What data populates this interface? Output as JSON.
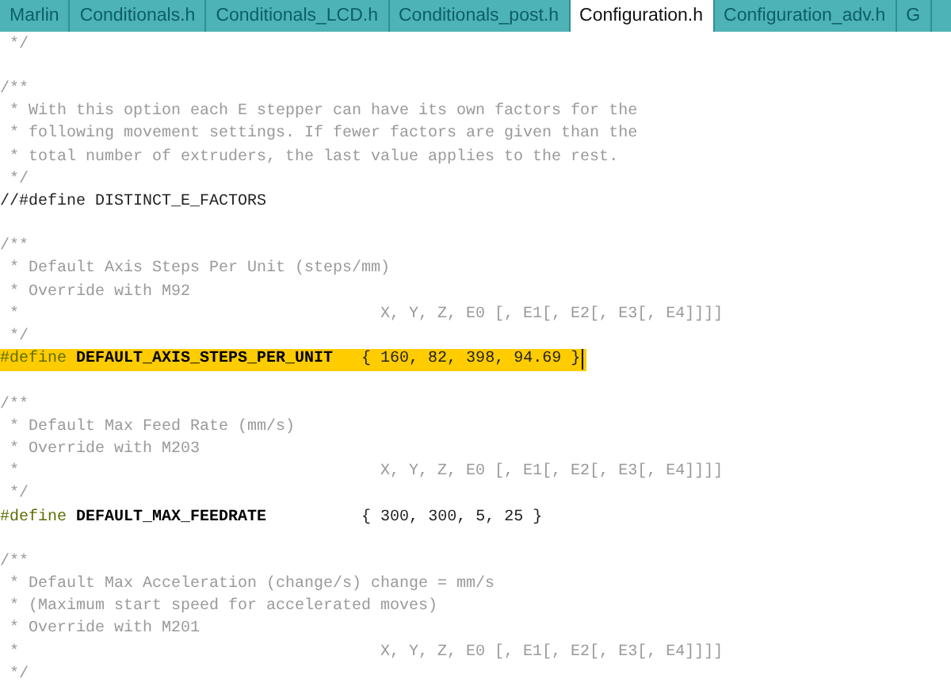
{
  "tabs": [
    {
      "label": "Marlin",
      "selected": false
    },
    {
      "label": "Conditionals.h",
      "selected": false
    },
    {
      "label": "Conditionals_LCD.h",
      "selected": false
    },
    {
      "label": "Conditionals_post.h",
      "selected": false
    },
    {
      "label": "Configuration.h",
      "selected": true
    },
    {
      "label": "Configuration_adv.h",
      "selected": false
    },
    {
      "label": "G",
      "selected": false
    }
  ],
  "lines": [
    {
      "highlighted": false,
      "tokens": [
        {
          "kind": "comment",
          "text": " */"
        }
      ]
    },
    {
      "highlighted": false
    },
    {
      "highlighted": false,
      "tokens": [
        {
          "kind": "comment",
          "text": "/**"
        }
      ]
    },
    {
      "highlighted": false,
      "tokens": [
        {
          "kind": "comment",
          "text": " * With this option each E stepper can have its own factors for the"
        }
      ]
    },
    {
      "highlighted": false,
      "tokens": [
        {
          "kind": "comment",
          "text": " * following movement settings. If fewer factors are given than the"
        }
      ]
    },
    {
      "highlighted": false,
      "tokens": [
        {
          "kind": "comment",
          "text": " * total number of extruders, the last value applies to the rest."
        }
      ]
    },
    {
      "highlighted": false,
      "tokens": [
        {
          "kind": "comment",
          "text": " */"
        }
      ]
    },
    {
      "highlighted": false,
      "tokens": [
        {
          "kind": "plain",
          "text": "//#define DISTINCT_E_FACTORS"
        }
      ]
    },
    {
      "highlighted": false
    },
    {
      "highlighted": false,
      "tokens": [
        {
          "kind": "comment",
          "text": "/**"
        }
      ]
    },
    {
      "highlighted": false,
      "tokens": [
        {
          "kind": "comment",
          "text": " * Default Axis Steps Per Unit (steps/mm)"
        }
      ]
    },
    {
      "highlighted": false,
      "tokens": [
        {
          "kind": "comment",
          "text": " * Override with M92"
        }
      ]
    },
    {
      "highlighted": false,
      "tokens": [
        {
          "kind": "comment",
          "text": " *                                      X, Y, Z, E0 [, E1[, E2[, E3[, E4]]]]"
        }
      ]
    },
    {
      "highlighted": false,
      "tokens": [
        {
          "kind": "comment",
          "text": " */"
        }
      ]
    },
    {
      "highlighted": true,
      "tokens": [
        {
          "kind": "directive",
          "text": "#define"
        },
        {
          "kind": "name",
          "text": " DEFAULT_AXIS_STEPS_PER_UNIT"
        },
        {
          "kind": "plain",
          "text": "   { 160, 82, 398, 94.69 }"
        }
      ]
    },
    {
      "highlighted": false
    },
    {
      "highlighted": false,
      "tokens": [
        {
          "kind": "comment",
          "text": "/**"
        }
      ]
    },
    {
      "highlighted": false,
      "tokens": [
        {
          "kind": "comment",
          "text": " * Default Max Feed Rate (mm/s)"
        }
      ]
    },
    {
      "highlighted": false,
      "tokens": [
        {
          "kind": "comment",
          "text": " * Override with M203"
        }
      ]
    },
    {
      "highlighted": false,
      "tokens": [
        {
          "kind": "comment",
          "text": " *                                      X, Y, Z, E0 [, E1[, E2[, E3[, E4]]]]"
        }
      ]
    },
    {
      "highlighted": false,
      "tokens": [
        {
          "kind": "comment",
          "text": " */"
        }
      ]
    },
    {
      "highlighted": false,
      "tokens": [
        {
          "kind": "directive",
          "text": "#define"
        },
        {
          "kind": "name",
          "text": " DEFAULT_MAX_FEEDRATE"
        },
        {
          "kind": "plain",
          "text": "          { 300, 300, 5, 25 }"
        }
      ]
    },
    {
      "highlighted": false
    },
    {
      "highlighted": false,
      "tokens": [
        {
          "kind": "comment",
          "text": "/**"
        }
      ]
    },
    {
      "highlighted": false,
      "tokens": [
        {
          "kind": "comment",
          "text": " * Default Max Acceleration (change/s) change = mm/s"
        }
      ]
    },
    {
      "highlighted": false,
      "tokens": [
        {
          "kind": "comment",
          "text": " * (Maximum start speed for accelerated moves)"
        }
      ]
    },
    {
      "highlighted": false,
      "tokens": [
        {
          "kind": "comment",
          "text": " * Override with M201"
        }
      ]
    },
    {
      "highlighted": false,
      "tokens": [
        {
          "kind": "comment",
          "text": " *                                      X, Y, Z, E0 [, E1[, E2[, E3[, E4]]]]"
        }
      ]
    },
    {
      "highlighted": false,
      "tokens": [
        {
          "kind": "comment",
          "text": " */"
        }
      ]
    }
  ]
}
